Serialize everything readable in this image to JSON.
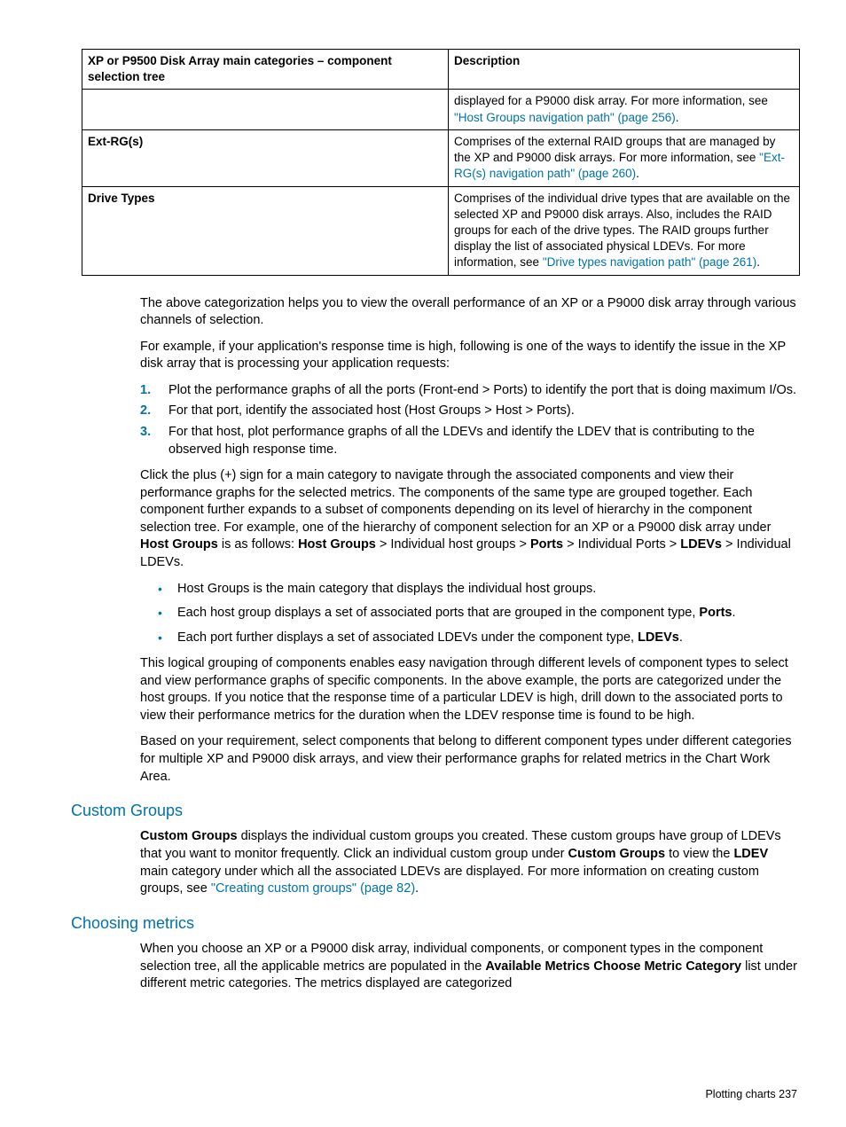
{
  "table": {
    "header1": "XP or P9500 Disk Array main categories – component selection tree",
    "header2": "Description",
    "row0_c1": "",
    "row0_c2_a": "displayed for a P9000 disk array. For more information, see ",
    "row0_c2_link": "\"Host Groups navigation path\" (page 256)",
    "row0_c2_b": ".",
    "row1_c1": "Ext-RG(s)",
    "row1_c2_a": "Comprises of the external RAID groups that are managed by the XP and P9000 disk arrays. For more information, see ",
    "row1_c2_link": "\"Ext-RG(s) navigation path\" (page 260)",
    "row1_c2_b": ".",
    "row2_c1": "Drive Types",
    "row2_c2_a": "Comprises of the individual drive types that are available on the selected XP and P9000 disk arrays. Also, includes the RAID groups for each of the drive types. The RAID groups further display the list of associated physical LDEVs. For more information, see ",
    "row2_c2_link": "\"Drive types navigation path\" (page 261)",
    "row2_c2_b": "."
  },
  "p1": "The above categorization helps you to view the overall performance of an XP or a P9000 disk array through various channels of selection.",
  "p2": "For example, if your application's response time is high, following is one of the ways to identify the issue in the XP disk array that is processing your application requests:",
  "list1": {
    "m1": "1.",
    "m2": "2.",
    "m3": "3.",
    "i1": "Plot the performance graphs of all the ports (Front-end > Ports) to identify the port that is doing maximum I/Os.",
    "i2": "For that port, identify the associated host (Host Groups > Host > Ports).",
    "i3": "For that host, plot performance graphs of all the LDEVs and identify the LDEV that is contributing to the observed high response time."
  },
  "p3a": "Click the plus (+) sign for a main category to navigate through the associated components and view their performance graphs for the selected metrics. The components of the same type are grouped together. Each component further expands to a subset of components depending on its level of hierarchy in the component selection tree. For example, one of the hierarchy of component selection for an XP or a P9000 disk array under ",
  "p3b1": "Host Groups",
  "p3c": " is as follows: ",
  "p3b2": "Host Groups",
  "p3d": " > Individual host groups > ",
  "p3b3": "Ports",
  "p3e": " > Individual Ports > ",
  "p3b4": "LDEVs",
  "p3f": " > Individual LDEVs.",
  "bullets": {
    "b1": "Host Groups is the main category that displays the individual host groups.",
    "b2a": "Each host group displays a set of associated ports that are grouped in the component type, ",
    "b2b": "Ports",
    "b2c": ".",
    "b3a": "Each port further displays a set of associated LDEVs under the component type, ",
    "b3b": "LDEVs",
    "b3c": "."
  },
  "p4": "This logical grouping of components enables easy navigation through different levels of component types to select and view performance graphs of specific components. In the above example, the ports are categorized under the host groups. If you notice that the response time of a particular LDEV is high, drill down to the associated ports to view their performance metrics for the duration when the LDEV response time is found to be high.",
  "p5": "Based on your requirement, select components that belong to different component types under different categories for multiple XP and P9000 disk arrays, and view their performance graphs for related metrics in the Chart Work Area.",
  "h1": "Custom Groups",
  "p6a": "Custom Groups",
  "p6b": " displays the individual custom groups you created. These custom groups have group of LDEVs that you want to monitor frequently. Click an individual custom group under ",
  "p6c": "Custom Groups",
  "p6d": " to view the ",
  "p6e": "LDEV",
  "p6f": " main category under which all the associated LDEVs are displayed. For more information on creating custom groups, see ",
  "p6link": "\"Creating custom groups\" (page 82)",
  "p6g": ".",
  "h2": "Choosing metrics",
  "p7a": "When you choose an XP or a P9000 disk array, individual components, or component types in the component selection tree, all the applicable metrics are populated in the ",
  "p7b": "Available Metrics Choose Metric Category",
  "p7c": " list under different metric categories. The metrics displayed are categorized",
  "footer": "Plotting charts    237"
}
